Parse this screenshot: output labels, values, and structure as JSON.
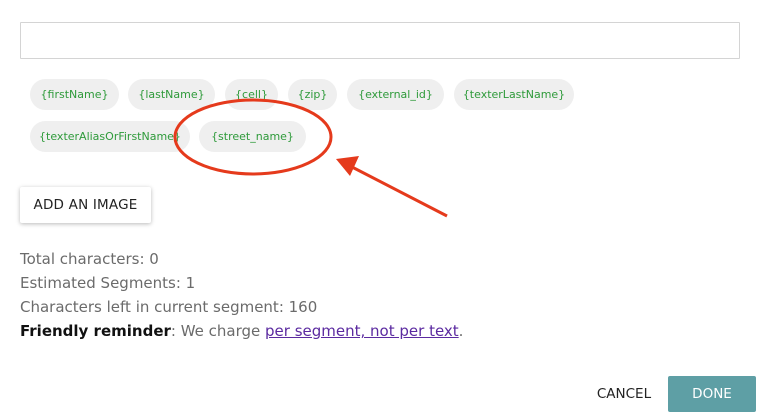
{
  "message_input": {
    "value": "",
    "placeholder": ""
  },
  "variables": {
    "chips": [
      "{firstName}",
      "{lastName}",
      "{cell}",
      "{zip}",
      "{external_id}",
      "{texterLastName}",
      "{texterAliasOrFirstName}",
      "{street_name}"
    ]
  },
  "add_image_label": "ADD AN IMAGE",
  "stats": {
    "total_characters": "Total characters: 0",
    "estimated_segments": "Estimated Segments: 1",
    "chars_left": "Characters left in current segment: 160"
  },
  "reminder": {
    "label": "Friendly reminder",
    "text": ": We charge ",
    "link": "per segment, not per text",
    "end": "."
  },
  "actions": {
    "cancel": "CANCEL",
    "done": "DONE"
  },
  "colors": {
    "chip_text": "#2e9a3a",
    "chip_bg": "#efefef",
    "done_bg": "#5e9fa5",
    "annotation_red": "#e53a1c",
    "link": "#5b2aa0"
  }
}
